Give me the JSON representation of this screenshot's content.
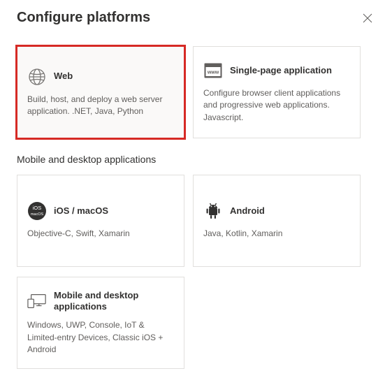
{
  "header": {
    "title": "Configure platforms"
  },
  "sections": {
    "top": {
      "cards": [
        {
          "title": "Web",
          "desc": "Build, host, and deploy a web server application. .NET, Java, Python",
          "icon": "globe-icon",
          "selected": true
        },
        {
          "title": "Single-page application",
          "desc": "Configure browser client applications and progressive web applications. Javascript.",
          "icon": "spa-www-icon",
          "selected": false
        }
      ]
    },
    "mobile": {
      "heading": "Mobile and desktop applications",
      "cards": [
        {
          "title": "iOS / macOS",
          "desc": "Objective-C, Swift, Xamarin",
          "icon": "ios-macos-icon"
        },
        {
          "title": "Android",
          "desc": "Java, Kotlin, Xamarin",
          "icon": "android-icon"
        },
        {
          "title": "Mobile and desktop applications",
          "desc": "Windows, UWP, Console, IoT & Limited-entry Devices, Classic iOS + Android",
          "icon": "devices-icon"
        }
      ]
    }
  }
}
